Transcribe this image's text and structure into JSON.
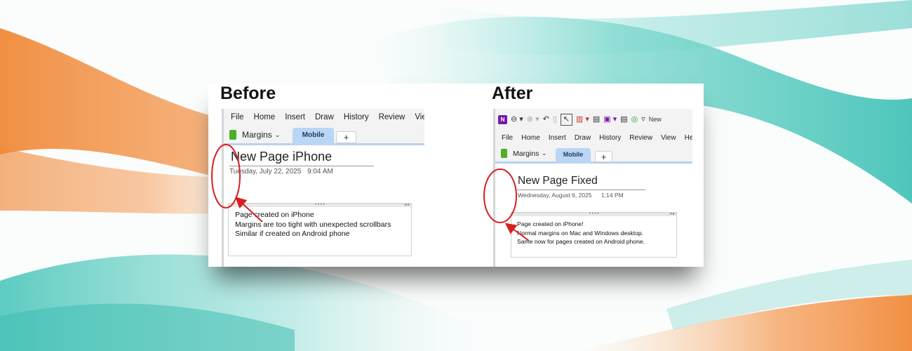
{
  "headings": {
    "before": "Before",
    "after": "After"
  },
  "before": {
    "menu": [
      "File",
      "Home",
      "Insert",
      "Draw",
      "History",
      "Review",
      "View"
    ],
    "notebook": "Margins",
    "tab_active": "Mobile",
    "tab_add": "+",
    "page_title": "New Page iPhone",
    "date": "Tuesday, July 22, 2025",
    "time": "9:04 AM",
    "lines": [
      "Page created on iPhone",
      "Margins are too tight with unexpected scrollbars",
      "Similar if created on Android phone"
    ]
  },
  "after": {
    "ribbon_more": "New",
    "menu": [
      "File",
      "Home",
      "Insert",
      "Draw",
      "History",
      "Review",
      "View",
      "Help"
    ],
    "notebook": "Margins",
    "tab_active": "Mobile",
    "tab_add": "+",
    "page_title": "New Page Fixed",
    "date": "Wednesday, August 6, 2025",
    "time": "1:14 PM",
    "lines": [
      "Page created on iPhone!",
      "Normal margins on Mac and Windows desktop.",
      "Same now for pages created on Android phone."
    ]
  },
  "colors": {
    "annotation_red": "#d61f1f",
    "tab_blue": "#b9d7f5",
    "notebook_green": "#4caf2a",
    "onenote_purple": "#7719aa",
    "teal_wave": "#5ccfc4",
    "orange_wave": "#f08a3a"
  }
}
